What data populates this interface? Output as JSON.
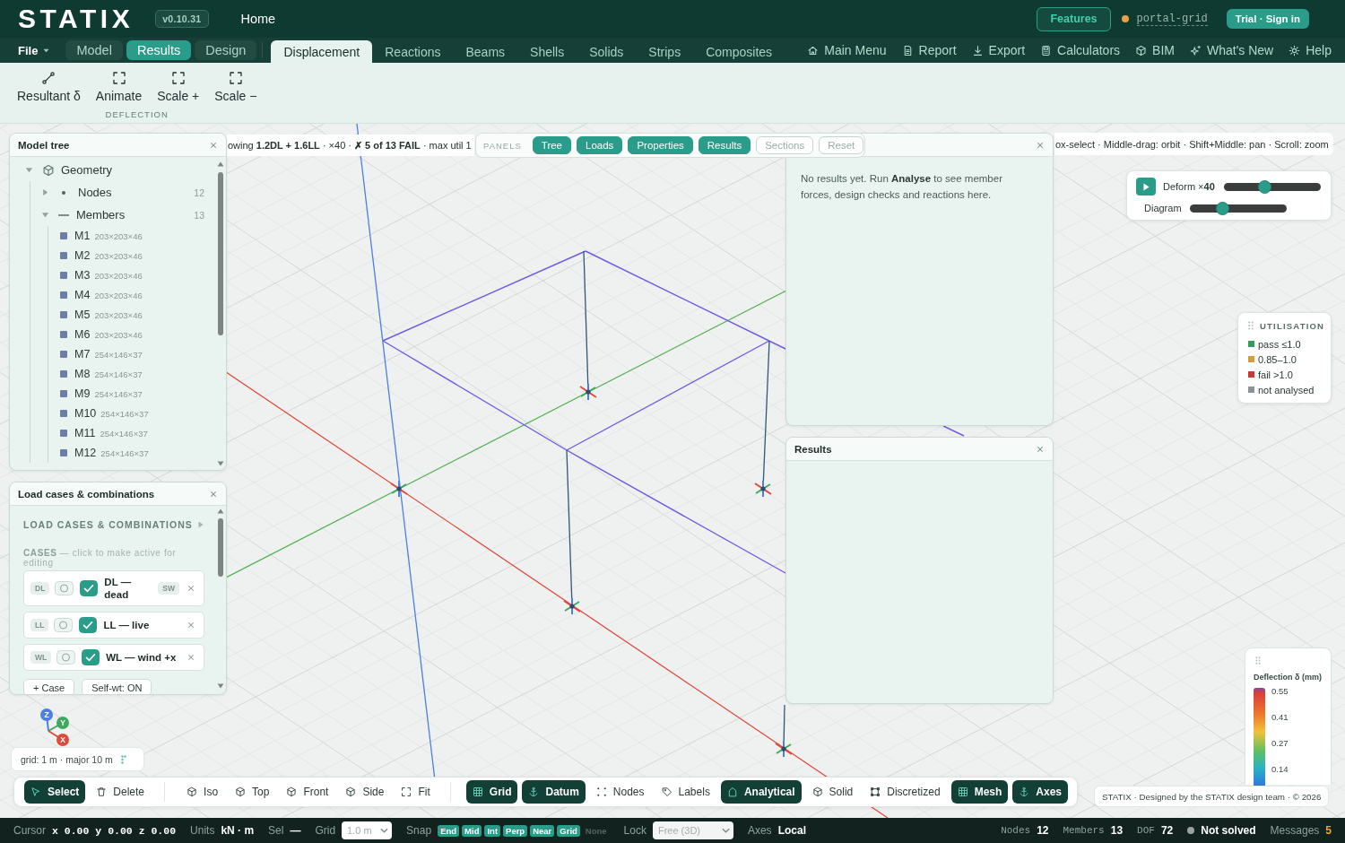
{
  "header": {
    "logo": "STATIX",
    "version": "v0.10.31",
    "home": "Home",
    "features": "Features",
    "project": "portal-grid",
    "sign_in": "Trial · Sign in"
  },
  "menu": {
    "file": "File",
    "modes": [
      {
        "label": "Model",
        "selected": false
      },
      {
        "label": "Results",
        "selected": true
      },
      {
        "label": "Design",
        "selected": false
      }
    ],
    "tabs": [
      {
        "label": "Displacement",
        "selected": true
      },
      {
        "label": "Reactions",
        "selected": false
      },
      {
        "label": "Beams",
        "selected": false
      },
      {
        "label": "Shells",
        "selected": false
      },
      {
        "label": "Solids",
        "selected": false
      },
      {
        "label": "Strips",
        "selected": false
      },
      {
        "label": "Composites",
        "selected": false
      }
    ],
    "links": [
      "Main Menu",
      "Report",
      "Export",
      "Calculators",
      "BIM",
      "What's New",
      "Help"
    ]
  },
  "ribbon": {
    "buttons": [
      "Resultant δ",
      "Animate",
      "Scale +",
      "Scale −"
    ],
    "group": "DEFLECTION"
  },
  "model_tree": {
    "title": "Model tree",
    "items": [
      {
        "label": "Geometry",
        "expanded": true,
        "children": [
          {
            "label": "Nodes",
            "count": "12",
            "expanded": false
          },
          {
            "label": "Members",
            "count": "13",
            "expanded": true,
            "children": [
              {
                "label": "M1",
                "section": "203×203×46"
              },
              {
                "label": "M2",
                "section": "203×203×46"
              },
              {
                "label": "M3",
                "section": "203×203×46"
              },
              {
                "label": "M4",
                "section": "203×203×46"
              },
              {
                "label": "M5",
                "section": "203×203×46"
              },
              {
                "label": "M6",
                "section": "203×203×46"
              },
              {
                "label": "M7",
                "section": "254×146×37"
              },
              {
                "label": "M8",
                "section": "254×146×37"
              },
              {
                "label": "M9",
                "section": "254×146×37"
              },
              {
                "label": "M10",
                "section": "254×146×37"
              },
              {
                "label": "M11",
                "section": "254×146×37"
              },
              {
                "label": "M12",
                "section": "254×146×37"
              }
            ]
          }
        ]
      }
    ]
  },
  "load_cases": {
    "title": "Load cases & combinations",
    "heading": "LOAD CASES & COMBINATIONS",
    "hint": "**CASES** — click to make active for editing",
    "cases": [
      {
        "tag": "DL",
        "active": false,
        "checked": true,
        "name": "DL — dead",
        "badge": "SW"
      },
      {
        "tag": "LL",
        "active": false,
        "checked": true,
        "name": "LL — live"
      },
      {
        "tag": "WL",
        "active": false,
        "checked": true,
        "name": "WL — wind +x"
      }
    ],
    "buttons": [
      "+ Case",
      "Self-wt: ON"
    ]
  },
  "summary": "owing **1.2DL + 1.6LL** · ×40 · **✗ 5 of 13 FAIL** · max util 1",
  "panels_bar": {
    "label": "PANELS",
    "toggles": [
      {
        "label": "Tree",
        "on": true
      },
      {
        "label": "Loads",
        "on": true
      },
      {
        "label": "Properties",
        "on": true
      },
      {
        "label": "Results",
        "on": true
      },
      {
        "label": "Sections",
        "on": false
      },
      {
        "label": "Reset",
        "on": false
      }
    ]
  },
  "hints": "ox-select · Middle-drag: orbit · Shift+Middle: pan · Scroll: zoom",
  "info_panel": {
    "message": "No results yet. Run **Analyse** to see member forces, design checks and reactions here."
  },
  "deform": {
    "sliders": [
      {
        "label": "Deform ×**40**",
        "level": 0.41
      },
      {
        "label": "Diagram",
        "level": 0.32
      }
    ]
  },
  "utilisation": {
    "title": "UTILISATION",
    "items": [
      {
        "label": "pass ≤1.0",
        "color": "#3a9a5c"
      },
      {
        "label": "0.85–1.0",
        "color": "#d89b3c"
      },
      {
        "label": "fail >1.0",
        "color": "#c9393a"
      },
      {
        "label": "not analysed",
        "color": "#8b9297"
      }
    ]
  },
  "results_panel": {
    "title": "Results"
  },
  "deflection_legend": {
    "title": "Deflection δ (mm)",
    "ticks": [
      "0.55",
      "0.41",
      "0.27",
      "0.14"
    ]
  },
  "triad": [
    "Z",
    "Y",
    "X"
  ],
  "grid_info": "grid: 1 m · major 10 m",
  "toolbar": {
    "groups": [
      [
        {
          "label": "Select",
          "on": true
        },
        {
          "label": "Delete",
          "on": false
        }
      ],
      [
        {
          "label": "Iso",
          "on": false
        },
        {
          "label": "Top",
          "on": false
        },
        {
          "label": "Front",
          "on": false
        },
        {
          "label": "Side",
          "on": false
        },
        {
          "label": "Fit",
          "on": false
        }
      ],
      [
        {
          "label": "Grid",
          "on": true
        },
        {
          "label": "Datum",
          "on": true
        },
        {
          "label": "Nodes",
          "on": false
        },
        {
          "label": "Labels",
          "on": false
        },
        {
          "label": "Analytical",
          "on": true
        },
        {
          "label": "Solid",
          "on": false
        },
        {
          "label": "Discretized",
          "on": false
        },
        {
          "label": "Mesh",
          "on": true
        },
        {
          "label": "Axes",
          "on": true
        }
      ]
    ]
  },
  "credit": "STATIX · Designed by the STATIX design team · © 2026",
  "status_bar": {
    "left": [
      {
        "kind": "coords",
        "label": "Cursor",
        "value": "x 0.00 y 0.00 z 0.00"
      },
      {
        "kind": "text",
        "label": "Units",
        "value": "kN · m"
      },
      {
        "kind": "text",
        "label": "Sel",
        "value": "—"
      },
      {
        "kind": "select",
        "label": "Grid",
        "value": "1.0 m"
      },
      {
        "kind": "chips",
        "label": "Snap",
        "chips": [
          {
            "label": "End",
            "on": true
          },
          {
            "label": "Mid",
            "on": true
          },
          {
            "label": "Int",
            "on": true
          },
          {
            "label": "Perp",
            "on": true
          },
          {
            "label": "Near",
            "on": true
          },
          {
            "label": "Grid",
            "on": true
          },
          {
            "label": "None",
            "on": false
          }
        ]
      },
      {
        "kind": "select",
        "label": "Lock",
        "value": "Free (3D)"
      },
      {
        "kind": "text",
        "label": "Axes",
        "value": "Local"
      }
    ],
    "right": [
      {
        "kind": "count",
        "label": "Nodes",
        "value": "12"
      },
      {
        "kind": "count",
        "label": "Members",
        "value": "13"
      },
      {
        "kind": "count",
        "label": "DOF",
        "value": "72"
      },
      {
        "kind": "status",
        "value": "Not solved"
      },
      {
        "kind": "alert",
        "label": "Messages",
        "value": "5"
      }
    ]
  }
}
